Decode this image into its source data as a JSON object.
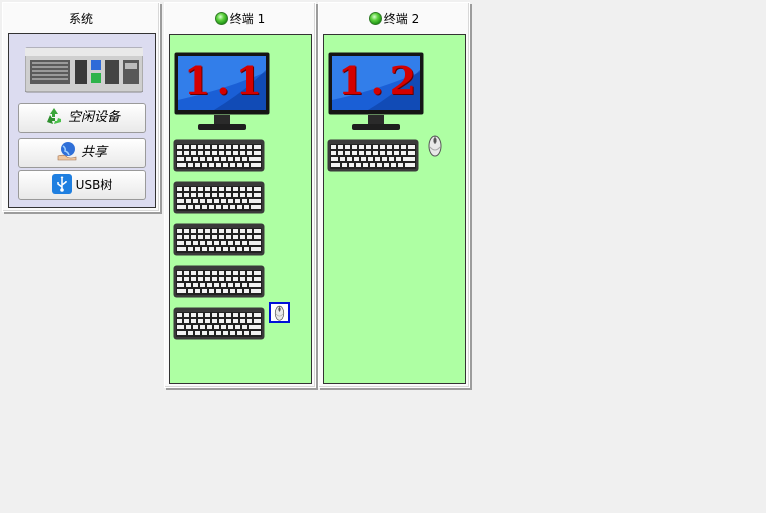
{
  "system": {
    "title": "系统",
    "buttons": [
      {
        "label": "空闲设备",
        "icon": "recycle-icon"
      },
      {
        "label": "共享",
        "icon": "globe-hand-icon"
      },
      {
        "label": "USB树",
        "icon": "usb-icon"
      }
    ]
  },
  "terminals": [
    {
      "title": "终端  1",
      "status": "online",
      "screen_label": "1.1",
      "keyboards": 5,
      "mouse_selected": true
    },
    {
      "title": "终端  2",
      "status": "online",
      "screen_label": "1.2",
      "keyboards": 1,
      "mouse_selected": false
    }
  ],
  "colors": {
    "terminal_bg": "#aeffa3",
    "system_bg": "#dcdcf0",
    "selection_border": "#0010d8",
    "screen_label": "#d40000"
  }
}
